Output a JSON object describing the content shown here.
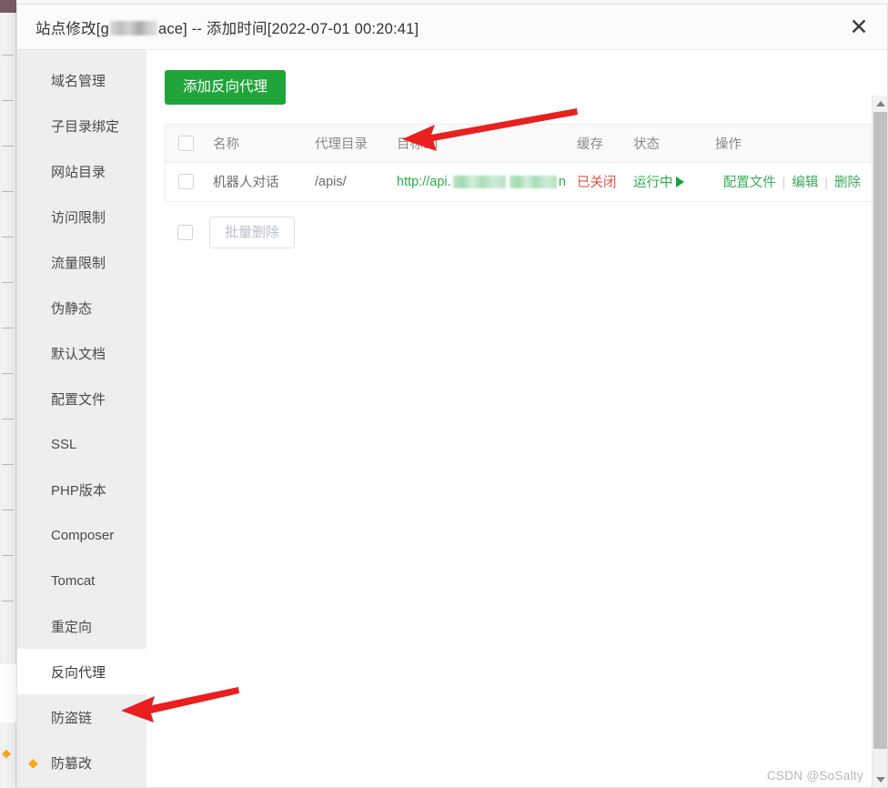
{
  "window": {
    "title_prefix": "站点修改[g",
    "title_suffix": "ace]  --  添加时间[2022-07-01 00:20:41]",
    "close_icon": "✕"
  },
  "sidebar": {
    "items": [
      {
        "label": "域名管理",
        "active": false,
        "icon": ""
      },
      {
        "label": "子目录绑定",
        "active": false,
        "icon": ""
      },
      {
        "label": "网站目录",
        "active": false,
        "icon": ""
      },
      {
        "label": "访问限制",
        "active": false,
        "icon": ""
      },
      {
        "label": "流量限制",
        "active": false,
        "icon": ""
      },
      {
        "label": "伪静态",
        "active": false,
        "icon": ""
      },
      {
        "label": "默认文档",
        "active": false,
        "icon": ""
      },
      {
        "label": "配置文件",
        "active": false,
        "icon": ""
      },
      {
        "label": "SSL",
        "active": false,
        "icon": ""
      },
      {
        "label": "PHP版本",
        "active": false,
        "icon": ""
      },
      {
        "label": "Composer",
        "active": false,
        "icon": ""
      },
      {
        "label": "Tomcat",
        "active": false,
        "icon": ""
      },
      {
        "label": "重定向",
        "active": false,
        "icon": ""
      },
      {
        "label": "反向代理",
        "active": true,
        "icon": ""
      },
      {
        "label": "防盗链",
        "active": false,
        "icon": ""
      },
      {
        "label": "防篡改",
        "active": false,
        "icon": "gem-icon"
      }
    ]
  },
  "content": {
    "add_button_label": "添加反向代理",
    "batch_delete_label": "批量删除",
    "table": {
      "headers": [
        "",
        "名称",
        "代理目录",
        "目标url",
        "缓存",
        "状态",
        "",
        "操作"
      ],
      "rows": [
        {
          "name": "机器人对话",
          "proxy_dir": "/apis/",
          "target_url_prefix": "http://api.",
          "target_url_suffix": "n",
          "cache": "已关闭",
          "status": "运行中",
          "ops": [
            "配置文件",
            "编辑",
            "删除"
          ],
          "op_separator": "|"
        }
      ]
    }
  },
  "scrollbar": {
    "up_icon": "chevron-up-icon",
    "down_icon": "chevron-down-icon"
  },
  "watermark": "CSDN @SoSalty",
  "colors": {
    "primary_green": "#20a53a",
    "link_green": "#3cab5a",
    "danger_red": "#e8504a",
    "annotation_red": "#e8201f",
    "sidebar_bg": "#eeeeee",
    "gem_orange": "#f7a81b"
  }
}
